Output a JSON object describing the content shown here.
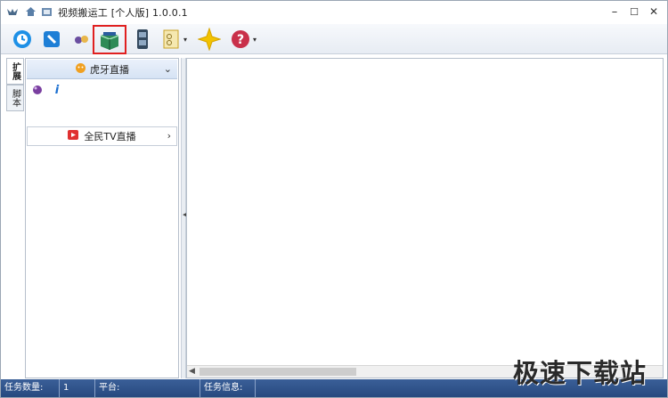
{
  "window": {
    "title": "视频搬运工 [个人版] 1.0.0.1"
  },
  "titlebar_icons": [
    "app-logo-icon",
    "home-icon",
    "folder-icon"
  ],
  "window_controls": {
    "minimize": "–",
    "maximize": "☐",
    "close": "✕"
  },
  "toolbar": {
    "tools": [
      {
        "name": "clock-icon",
        "glyph": "◔",
        "color": "#1e90e6"
      },
      {
        "name": "tag-icon",
        "glyph": "✎",
        "color": "#1e7fd6"
      },
      {
        "name": "users-icon",
        "glyph": "●●",
        "color": "#6a4ea0"
      },
      {
        "name": "box-icon",
        "glyph": "▣",
        "color": "#2e8b57",
        "selected": true
      },
      {
        "name": "film-icon",
        "glyph": "▮",
        "color": "#34495e"
      },
      {
        "name": "document-icon",
        "glyph": "▤",
        "color": "#c9a227",
        "dropdown": true
      },
      {
        "name": "star-icon",
        "glyph": "✦",
        "color": "#f2c200"
      },
      {
        "name": "help-icon",
        "glyph": "?",
        "color": "#c9304a",
        "dropdown": true
      }
    ]
  },
  "side_tabs": [
    {
      "label": "扩展",
      "active": true
    },
    {
      "label": "脚本",
      "active": false
    }
  ],
  "left_panel": {
    "group1": {
      "label": "虎牙直播",
      "chevron": "⌄"
    },
    "group2": {
      "label": "全民TV直播",
      "chevron": "›"
    },
    "small_icons": [
      {
        "name": "ball-icon",
        "glyph": "●",
        "color": "#7a3fa0"
      },
      {
        "name": "info-icon",
        "glyph": "i",
        "color": "#1b6fd0"
      }
    ]
  },
  "statusbar": {
    "task_count_label": "任务数量:",
    "task_count_value": "1",
    "platform_label": "平台:",
    "platform_value": "",
    "task_info_label": "任务信息:"
  },
  "watermark": "极速下载站"
}
